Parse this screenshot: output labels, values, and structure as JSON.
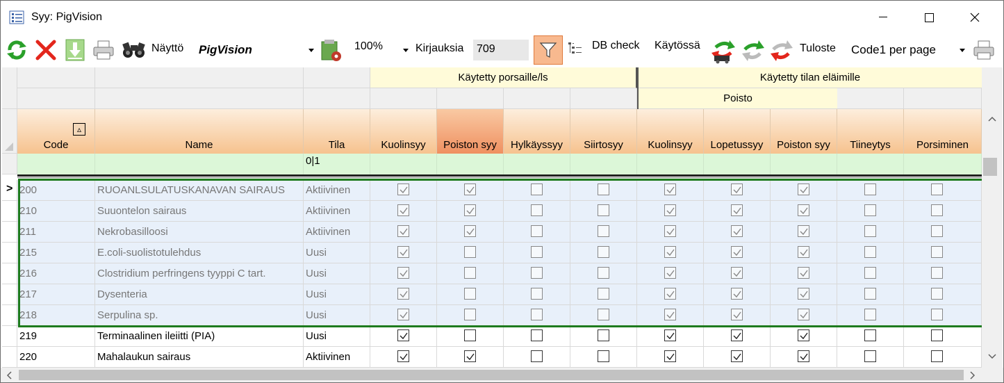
{
  "window": {
    "title": "Syy: PigVision"
  },
  "toolbar": {
    "display_label": "Näyttö",
    "display_value": "PigVision",
    "zoom_value": "100%",
    "records_label": "Kirjauksia",
    "records_value": "709",
    "db_check_label": "DB check",
    "in_use_label": "Käytössä",
    "print_label": "Tuloste",
    "print_value": "Code1 per page"
  },
  "grid": {
    "group_headers": {
      "piglets": "Käytetty porsaille/ls",
      "farm": "Käytetty tilan eläimille",
      "removal": "Poisto"
    },
    "columns": [
      "Code",
      "Name",
      "Tila",
      "Kuolinsyy",
      "Poiston syy",
      "Hylkäyssyy",
      "Siirtosyy",
      "Kuolinsyy",
      "Lopetussyy",
      "Poiston syy",
      "Tiineytys",
      "Porsiminen"
    ],
    "sort_indicator": "▵",
    "filter_tila": "0|1",
    "current_row_marker": ">",
    "rows": [
      {
        "code": "200",
        "name": "RUOANLSULATUSKANAVAN SAIRAUS",
        "tila": "Aktiivinen",
        "checks": [
          1,
          1,
          0,
          0,
          1,
          1,
          1,
          0,
          0
        ]
      },
      {
        "code": "210",
        "name": "Suuontelon sairaus",
        "tila": "Aktiivinen",
        "checks": [
          1,
          1,
          0,
          0,
          1,
          1,
          1,
          0,
          0
        ]
      },
      {
        "code": "211",
        "name": "Nekrobasilloosi",
        "tila": "Aktiivinen",
        "checks": [
          1,
          1,
          0,
          0,
          1,
          1,
          1,
          0,
          0
        ]
      },
      {
        "code": "215",
        "name": "E.coli-suolistotulehdus",
        "tila": "Uusi",
        "checks": [
          1,
          0,
          0,
          0,
          1,
          1,
          1,
          0,
          0
        ]
      },
      {
        "code": "216",
        "name": "Clostridium perfringens tyyppi C tart.",
        "tila": "Uusi",
        "checks": [
          1,
          0,
          0,
          0,
          1,
          1,
          1,
          0,
          0
        ]
      },
      {
        "code": "217",
        "name": "Dysenteria",
        "tila": "Uusi",
        "checks": [
          1,
          0,
          0,
          0,
          1,
          1,
          1,
          0,
          0
        ]
      },
      {
        "code": "218",
        "name": "Serpulina sp.",
        "tila": "Uusi",
        "checks": [
          1,
          0,
          0,
          0,
          1,
          1,
          1,
          0,
          0
        ]
      },
      {
        "code": "219",
        "name": "Terminaalinen ileiitti (PIA)",
        "tila": "Uusi",
        "checks": [
          1,
          0,
          0,
          0,
          1,
          1,
          1,
          0,
          0
        ]
      },
      {
        "code": "220",
        "name": "Mahalaukun sairaus",
        "tila": "Aktiivinen",
        "checks": [
          1,
          1,
          0,
          0,
          1,
          1,
          1,
          0,
          0
        ]
      }
    ],
    "selected_rows": 7
  },
  "colors": {
    "selection_border": "#1e7b1e",
    "header_orange": "#f6c28e",
    "filter_green": "#dcf7d8"
  }
}
